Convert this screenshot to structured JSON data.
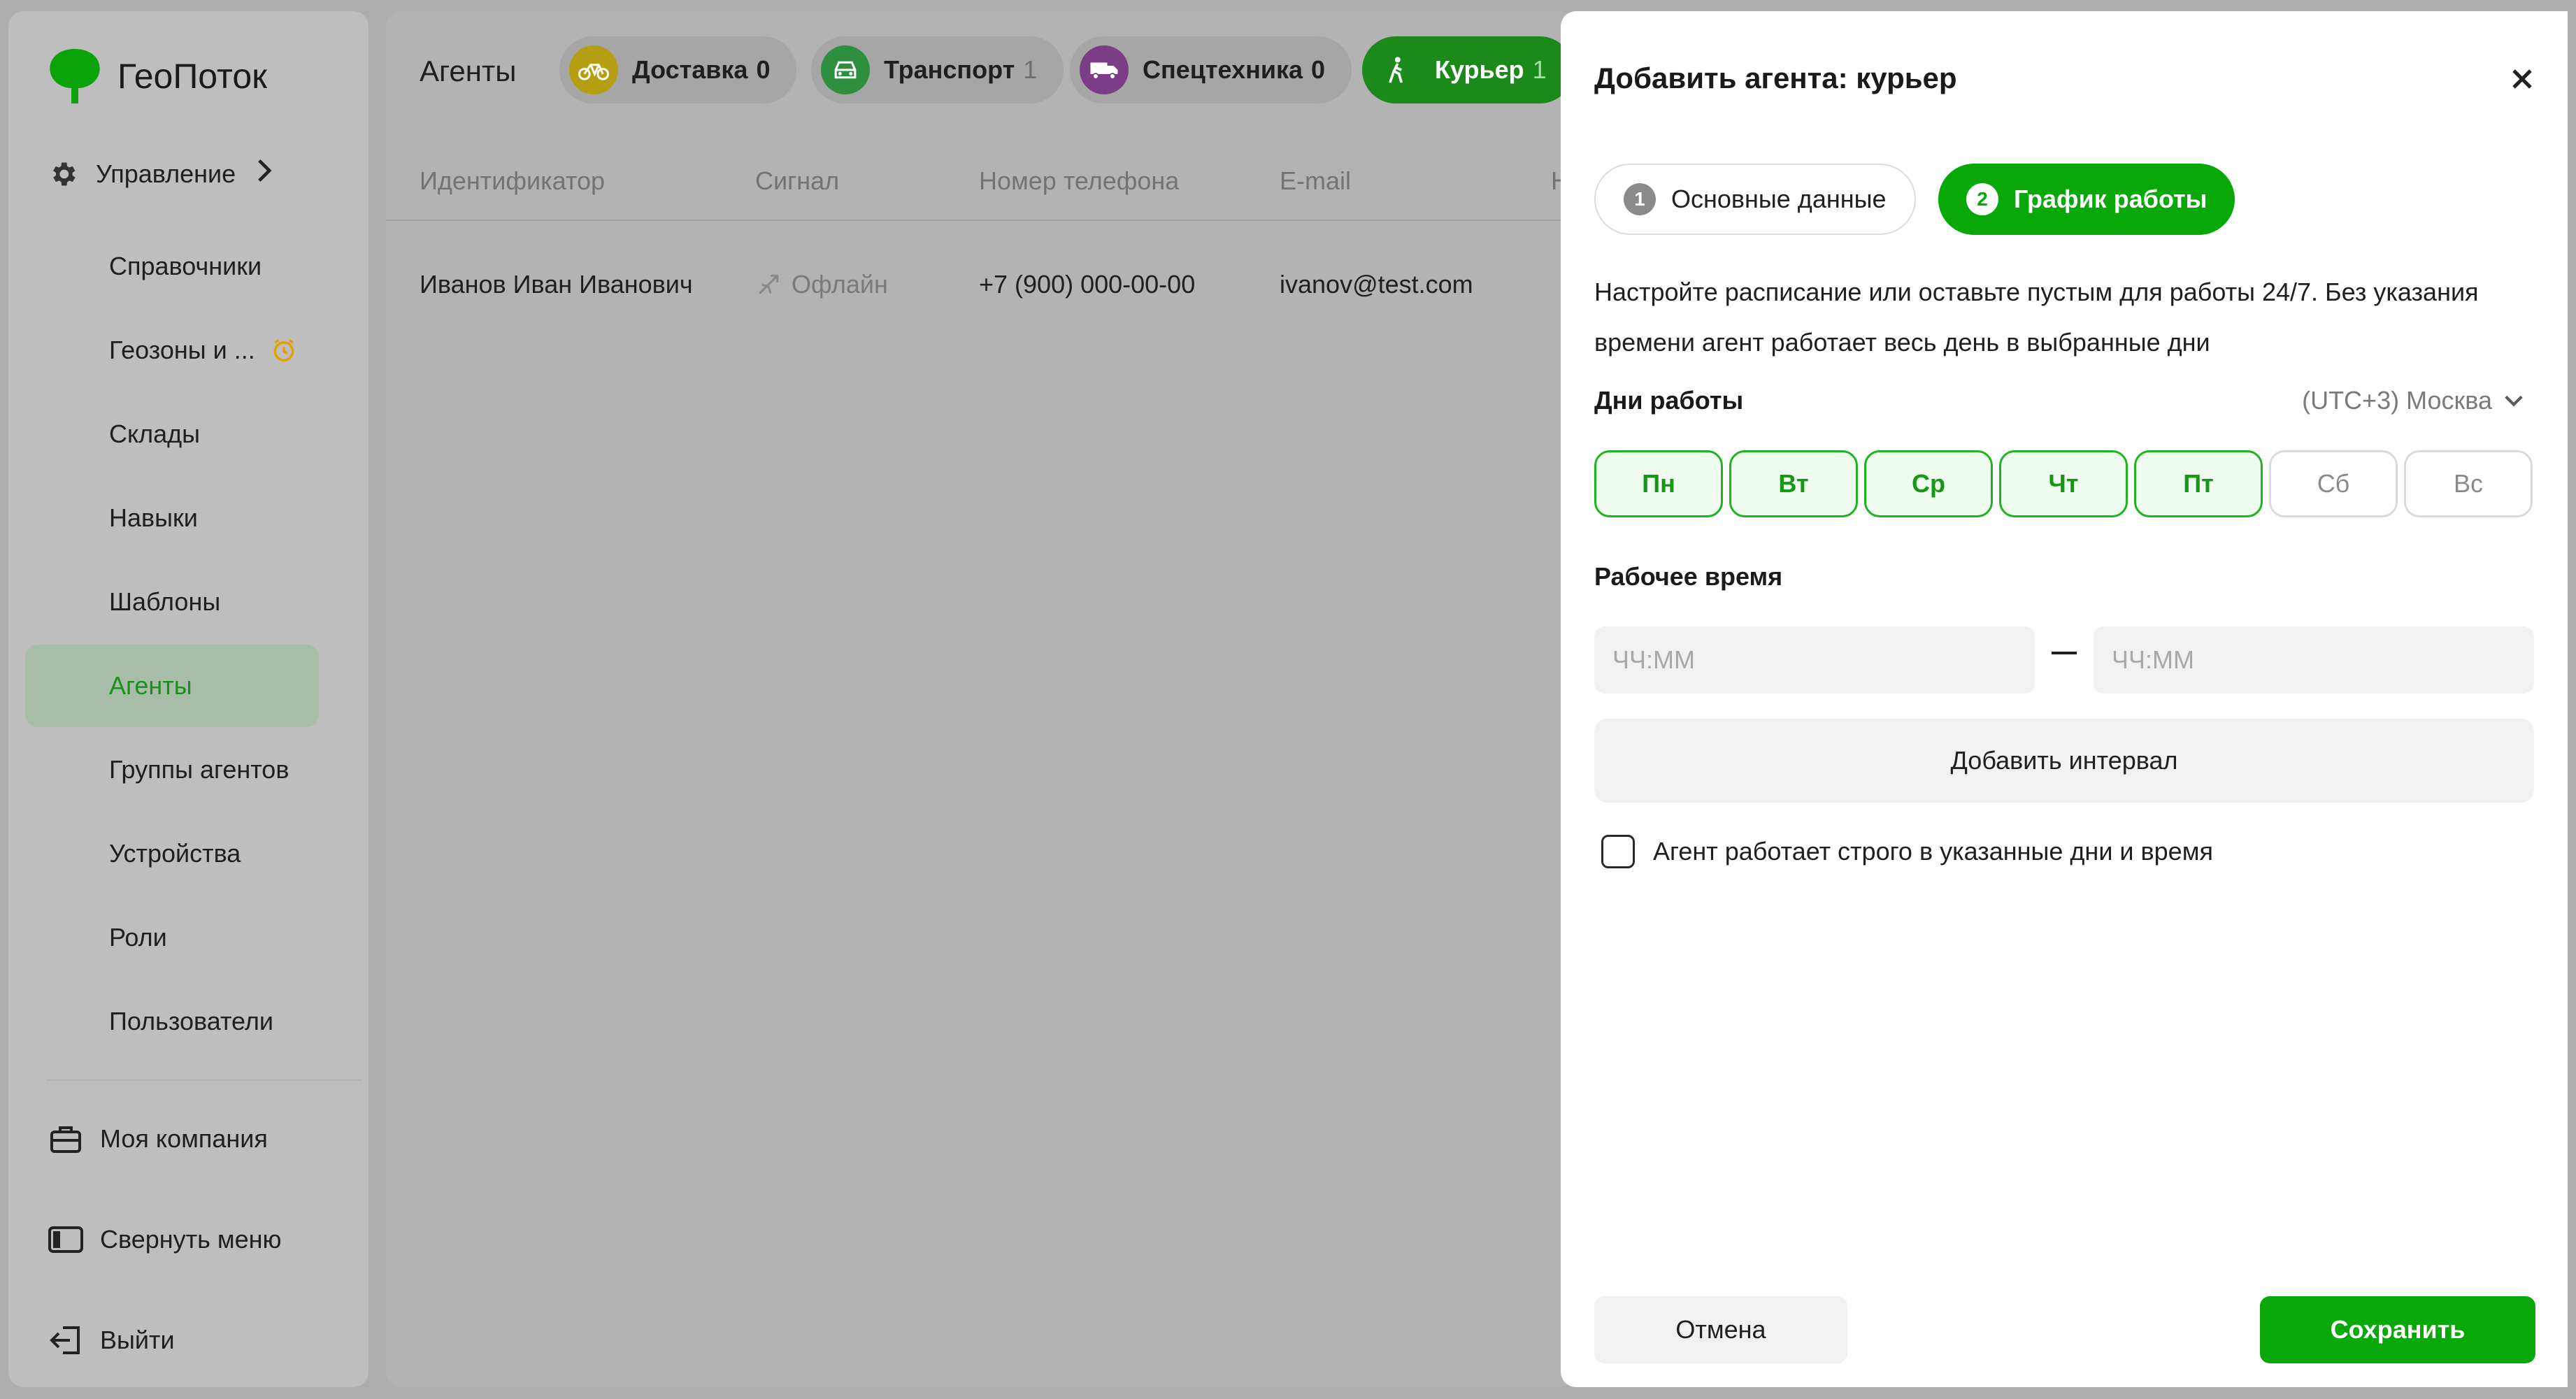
{
  "app": {
    "name": "ГеоПоток",
    "accent": "#08a808"
  },
  "sidebar": {
    "section": {
      "label": "Управление",
      "icon": "gear-icon"
    },
    "items": [
      {
        "label": "Справочники"
      },
      {
        "label": "Геозоны и ...",
        "badge_icon": "clock-warning-icon"
      },
      {
        "label": "Склады"
      },
      {
        "label": "Навыки"
      },
      {
        "label": "Шаблоны"
      },
      {
        "label": "Агенты",
        "active": true
      },
      {
        "label": "Группы агентов"
      },
      {
        "label": "Устройства"
      },
      {
        "label": "Роли"
      },
      {
        "label": "Пользователи"
      }
    ],
    "bottom": [
      {
        "label": "Моя компания",
        "icon": "briefcase-icon"
      },
      {
        "label": "Свернуть меню",
        "icon": "collapse-menu-icon"
      },
      {
        "label": "Выйти",
        "icon": "logout-icon"
      }
    ]
  },
  "main": {
    "title": "Агенты",
    "tabs": [
      {
        "label": "Доставка",
        "count": "0",
        "icon": "bicycle-icon",
        "color": "#b59e12"
      },
      {
        "label": "Транспорт",
        "count": "1",
        "icon": "car-icon",
        "color": "#2e8f3e"
      },
      {
        "label": "Спецтехника",
        "count": "0",
        "icon": "truck-icon",
        "color": "#7a3d86"
      },
      {
        "label": "Курьер",
        "count": "1",
        "icon": "walker-icon",
        "active": true
      }
    ],
    "columns": [
      "Идентификатор",
      "Сигнал",
      "Номер телефона",
      "E-mail",
      "Н"
    ],
    "rows": [
      {
        "name": "Иванов Иван Иванович",
        "signal": "Офлайн",
        "phone": "+7 (900) 000-00-00",
        "email": "ivanov@test.com"
      }
    ]
  },
  "drawer": {
    "title": "Добавить агента: курьер",
    "steps": [
      {
        "num": "1",
        "label": "Основные данные"
      },
      {
        "num": "2",
        "label": "График работы"
      }
    ],
    "description": "Настройте расписание или оставьте пустым для работы 24/7. Без указания времени агент работает весь день в выбранные дни",
    "days_label": "Дни работы",
    "timezone": "(UTC+3) Москва",
    "days": [
      {
        "label": "Пн",
        "selected": true
      },
      {
        "label": "Вт",
        "selected": true
      },
      {
        "label": "Ср",
        "selected": true
      },
      {
        "label": "Чт",
        "selected": true
      },
      {
        "label": "Пт",
        "selected": true
      },
      {
        "label": "Сб",
        "selected": false
      },
      {
        "label": "Вс",
        "selected": false
      }
    ],
    "time_label": "Рабочее время",
    "time_from": {
      "value": "",
      "placeholder": "ЧЧ:ММ"
    },
    "time_to": {
      "value": "",
      "placeholder": "ЧЧ:ММ"
    },
    "add_interval": "Добавить интервал",
    "strict_checkbox": {
      "label": "Агент работает строго в указанные дни и время",
      "checked": false
    },
    "cancel": "Отмена",
    "save": "Сохранить"
  }
}
